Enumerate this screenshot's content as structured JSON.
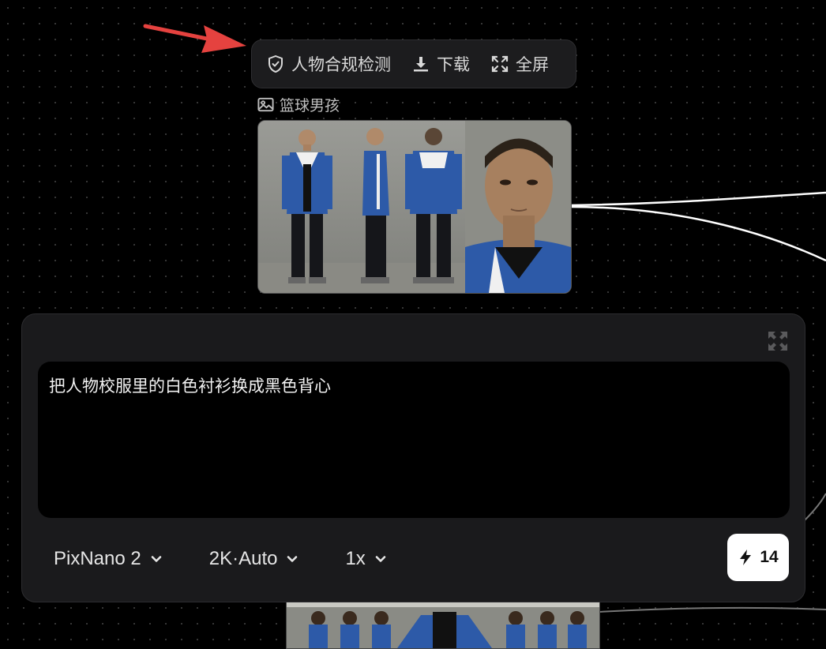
{
  "toolbar": {
    "compliance_label": "人物合规检测",
    "download_label": "下载",
    "fullscreen_label": "全屏"
  },
  "node": {
    "label": "篮球男孩",
    "icons": {
      "label_icon": "image-icon"
    }
  },
  "prompt": {
    "text": "把人物校服里的白色衬衫换成黑色背心"
  },
  "controls": {
    "model": "PixNano 2",
    "resolution": "2K·Auto",
    "count": "1x",
    "credits": "14"
  },
  "colors": {
    "background": "#000000",
    "panel": "#1a1a1c",
    "arrow": "#e5423f",
    "jacket_blue": "#2d5aa8",
    "credit_button": "#ffffff"
  }
}
